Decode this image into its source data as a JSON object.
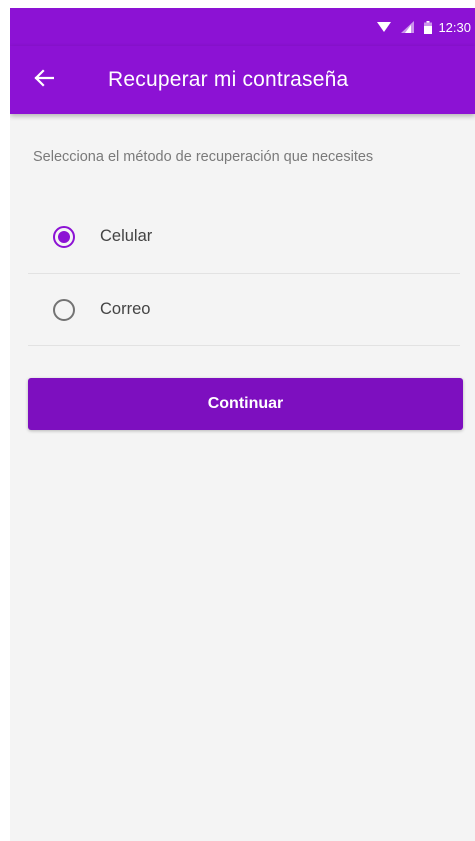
{
  "status_bar": {
    "time": "12:30",
    "icons": [
      "wifi-icon",
      "signal-icon",
      "battery-icon"
    ]
  },
  "app_bar": {
    "back_icon": "arrow-back-icon",
    "title": "Recuperar mi contraseña"
  },
  "instruction": "Selecciona el método de recuperación que necesites",
  "options": [
    {
      "label": "Celular",
      "selected": true
    },
    {
      "label": "Correo",
      "selected": false
    }
  ],
  "continue_label": "Continuar",
  "colors": {
    "primary": "#8c12d4",
    "button": "#7d0fbf",
    "background": "#f4f4f4"
  }
}
